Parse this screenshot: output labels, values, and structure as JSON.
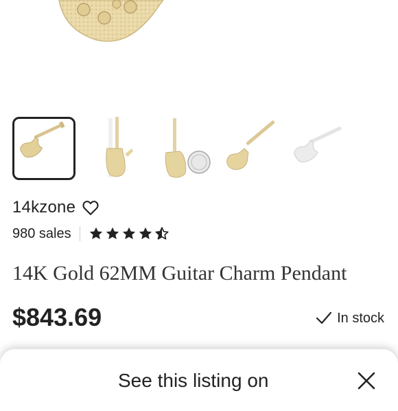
{
  "product": {
    "thumbnails": [
      {
        "name": "thumbnail-1",
        "selected": true
      },
      {
        "name": "thumbnail-2",
        "selected": false
      },
      {
        "name": "thumbnail-3",
        "selected": false
      },
      {
        "name": "thumbnail-4",
        "selected": false
      },
      {
        "name": "thumbnail-5",
        "selected": false
      }
    ],
    "shop_name": "14kzone",
    "favorite_icon": "heart-outline-icon",
    "sales": "980 sales",
    "rating": 4.5,
    "rating_max": 5,
    "title": "14K Gold 62MM Guitar Charm Pendant",
    "price": "$843.69",
    "stock_icon": "checkmark-icon",
    "stock": "In stock"
  },
  "bottom_sheet": {
    "text": "See this listing on",
    "close_icon": "close-icon"
  },
  "colors": {
    "gold": "#e6d29a",
    "gold_dark": "#c8b27a",
    "text": "#222222"
  }
}
